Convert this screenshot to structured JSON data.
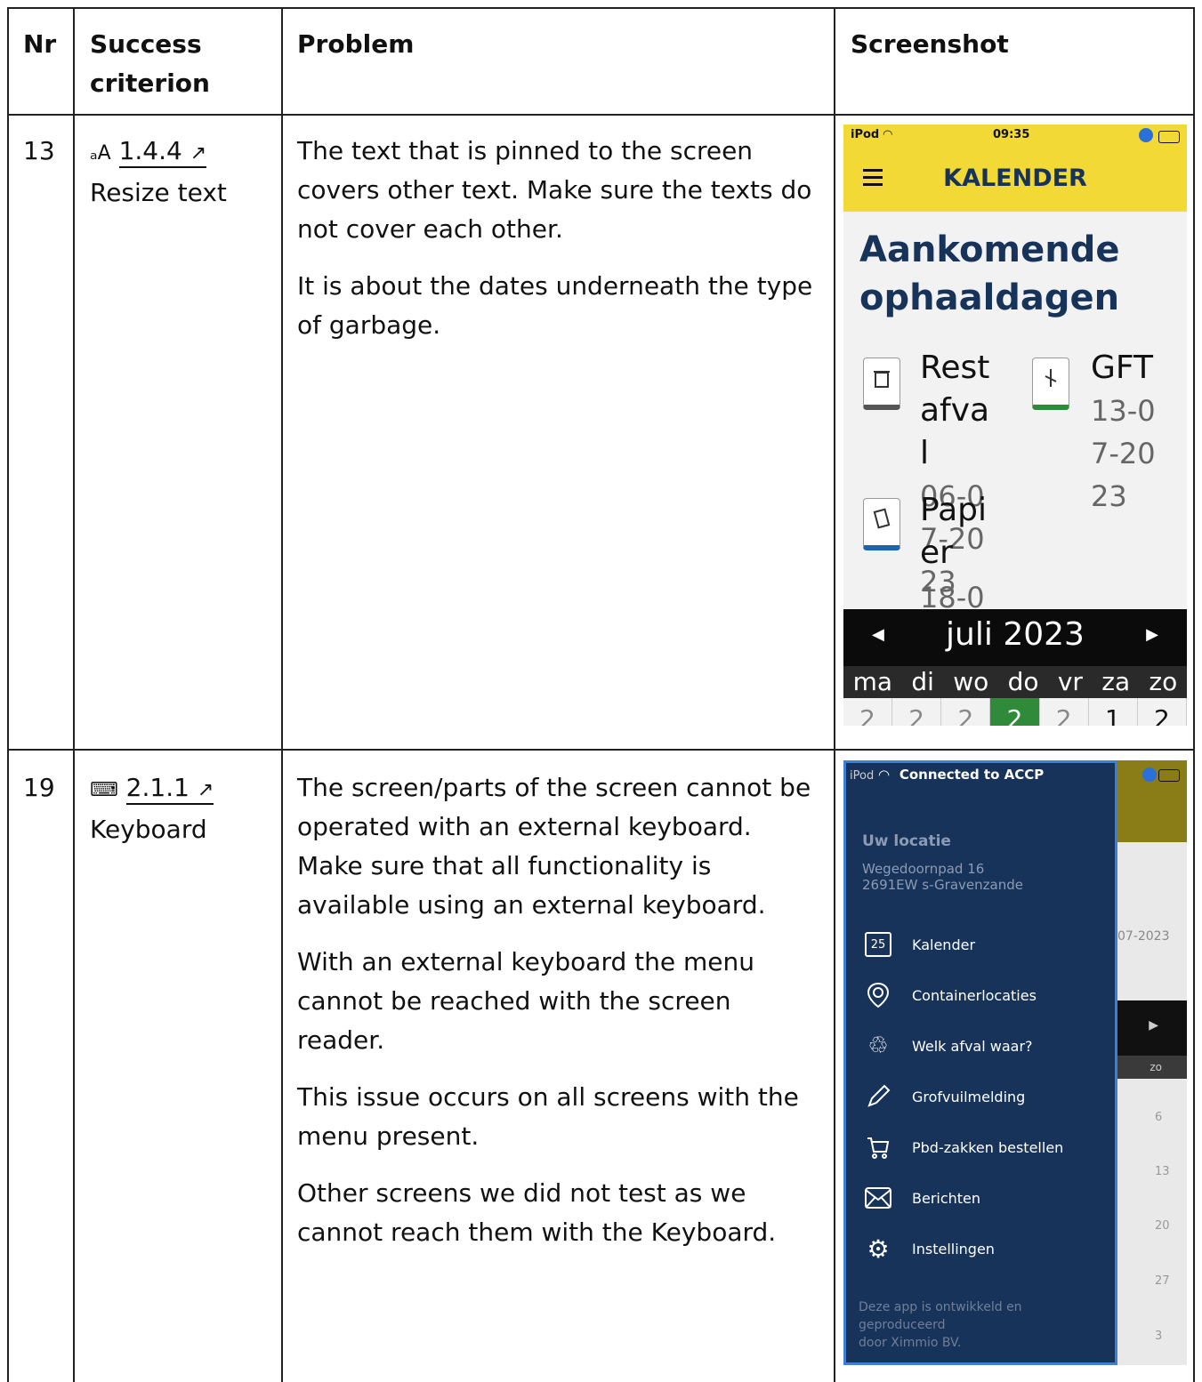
{
  "table": {
    "headers": {
      "nr": "Nr",
      "criterion": "Success criterion",
      "problem": "Problem",
      "screenshot": "Screenshot"
    },
    "rows": [
      {
        "nr": "13",
        "criterion_icon": "text-resize-icon",
        "criterion_glyph": "ₐA",
        "criterion_code": "1.4.4",
        "criterion_name": "Resize text",
        "problem": [
          "The text that is pinned to the screen covers other text. Make sure the texts do not cover each other.",
          "It is about the dates underneath the type of garbage."
        ]
      },
      {
        "nr": "19",
        "criterion_icon": "keyboard-icon",
        "criterion_glyph": "⌨",
        "criterion_code": "2.1.1",
        "criterion_name": "Keyboard",
        "problem": [
          "The screen/parts of the screen cannot be operated with an external keyboard. Make sure that all functionality is available using an external keyboard.",
          "With an external keyboard the menu cannot be reached with the screen reader.",
          "This issue occurs on all screens with the menu present.",
          "Other screens we did not test as we cannot reach them with the Keyboard."
        ]
      }
    ]
  },
  "phone1": {
    "status_left": "iPod",
    "status_time": "09:35",
    "title": "KALENDER",
    "heading_line1": "Aankomende",
    "heading_line2": "ophaaldagen",
    "rest_lines": [
      "Rest",
      "afva",
      "l"
    ],
    "rest_date_lines": [
      "06-0",
      "7-20",
      "23"
    ],
    "gft": "GFT",
    "gft_date_lines": [
      "13-0",
      "7-20",
      "23"
    ],
    "papier_lines": [
      "Papi",
      "er"
    ],
    "papier_date": "18-0",
    "month": "juli 2023",
    "weekdays": [
      "ma",
      "di",
      "wo",
      "do",
      "vr",
      "za",
      "zo"
    ],
    "days": [
      "2",
      "2",
      "2",
      "2",
      "2",
      "1",
      "2"
    ]
  },
  "phone2": {
    "status_left": "iPod",
    "status_center": "Connected to ACCP",
    "location_label": "Uw locatie",
    "address_line1": "Wegedoornpad 16",
    "address_line2": "2691EW s-Gravenzande",
    "behind_date": "07-2023",
    "menu": [
      {
        "label": "Kalender",
        "icon": "calendar-icon"
      },
      {
        "label": "Containerlocaties",
        "icon": "location-pin-icon"
      },
      {
        "label": "Welk afval waar?",
        "icon": "recycle-icon"
      },
      {
        "label": "Grofvuilmelding",
        "icon": "pencil-icon"
      },
      {
        "label": "Pbd-zakken bestellen",
        "icon": "cart-icon"
      },
      {
        "label": "Berichten",
        "icon": "mail-icon"
      },
      {
        "label": "Instellingen",
        "icon": "gear-icon"
      }
    ],
    "footer_lines": [
      "Deze app is ontwikkeld en",
      "geproduceerd",
      "door Ximmio BV."
    ],
    "behind_zo": "zo",
    "behind_numbers": [
      "6",
      "13",
      "20",
      "27",
      "3"
    ],
    "calendar_day_icon": "25"
  }
}
